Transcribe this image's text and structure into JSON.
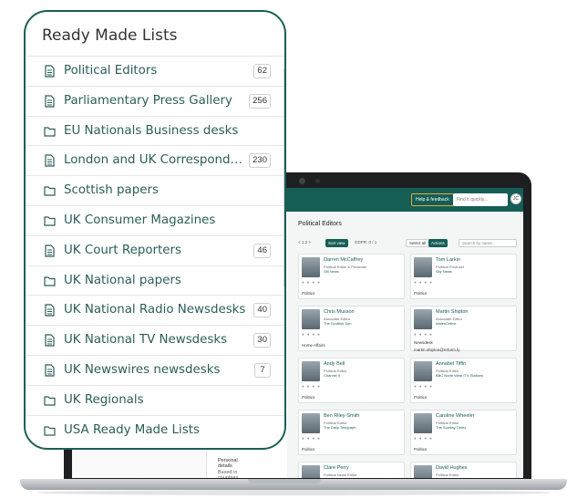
{
  "colors": {
    "brand": "#155e55",
    "panel_border": "#1b5f56",
    "list_text": "#2c5e5a"
  },
  "panel": {
    "title": "Ready Made Lists",
    "items": [
      {
        "label": "Political Editors",
        "icon": "document-icon",
        "count": "62"
      },
      {
        "label": "Parliamentary Press Gallery",
        "icon": "document-icon",
        "count": "256"
      },
      {
        "label": "EU Nationals Business desks",
        "icon": "folder-icon",
        "count": null
      },
      {
        "label": "London and UK Correspondents",
        "icon": "document-icon",
        "count": "230"
      },
      {
        "label": "Scottish papers",
        "icon": "folder-icon",
        "count": null
      },
      {
        "label": "UK Consumer Magazines",
        "icon": "folder-icon",
        "count": null
      },
      {
        "label": "UK Court Reporters",
        "icon": "document-icon",
        "count": "46"
      },
      {
        "label": "UK National papers",
        "icon": "folder-icon",
        "count": null
      },
      {
        "label": "UK National Radio Newsdesks",
        "icon": "document-icon",
        "count": "40"
      },
      {
        "label": "UK National TV Newsdesks",
        "icon": "document-icon",
        "count": "30"
      },
      {
        "label": "UK Newswires newsdesks",
        "icon": "document-icon",
        "count": "7"
      },
      {
        "label": "UK Regionals",
        "icon": "folder-icon",
        "count": null
      },
      {
        "label": "USA Ready Made Lists",
        "icon": "folder-icon",
        "count": null
      }
    ]
  },
  "app": {
    "help_label": "Help & feedback",
    "search_placeholder": "Find it quickly...",
    "avatar_initials": "JC",
    "page_title": "Political Editors",
    "pager_text": "< 1 2 >",
    "sort_label": "Sort view",
    "gdpr_label": "GDPR: 0 / 1",
    "select_all_label": "Select all",
    "actions_label": "Actions",
    "main_search_placeholder": "Search by name...",
    "sidebar_details": [
      "Personal details",
      "Based in countries"
    ],
    "cards": [
      {
        "name": "Darren McCaffrey",
        "role": "Political Editor & Presenter",
        "outlet": "GB News",
        "tag": "Politics"
      },
      {
        "name": "Tom Larkin",
        "role": "Political Producer",
        "outlet": "Sky News",
        "tag": "Politics"
      },
      {
        "name": "Chris Musson",
        "role": "Associate Editor",
        "outlet": "The Scottish Sun",
        "tag": "Home Affairs"
      },
      {
        "name": "Martin Shipton",
        "role": "Associate Editor",
        "outlet": "WalesOnline",
        "line1": "Newsdesk",
        "line2": "martin.shipton@reform.ly"
      },
      {
        "name": "Andy Bell",
        "role": "Political Editor",
        "outlet": "Channel 5",
        "tag": "Politics"
      },
      {
        "name": "Annabel Tiffin",
        "role": "Political Editor",
        "outlet": "BBC North West ITV Stations",
        "tag": "Politics"
      },
      {
        "name": "Ben Riley-Smith",
        "role": "Political Editor",
        "outlet": "The Daily Telegraph",
        "tag": "Politics"
      },
      {
        "name": "Caroline Wheeler",
        "role": "Political Editor",
        "outlet": "The Sunday Times",
        "tag": "Politics"
      },
      {
        "name": "Clare Perry",
        "role": "Political News Editor",
        "outlet": "",
        "tag": ""
      },
      {
        "name": "David Hughes",
        "role": "Political Editor",
        "outlet": "",
        "tag": ""
      }
    ]
  }
}
